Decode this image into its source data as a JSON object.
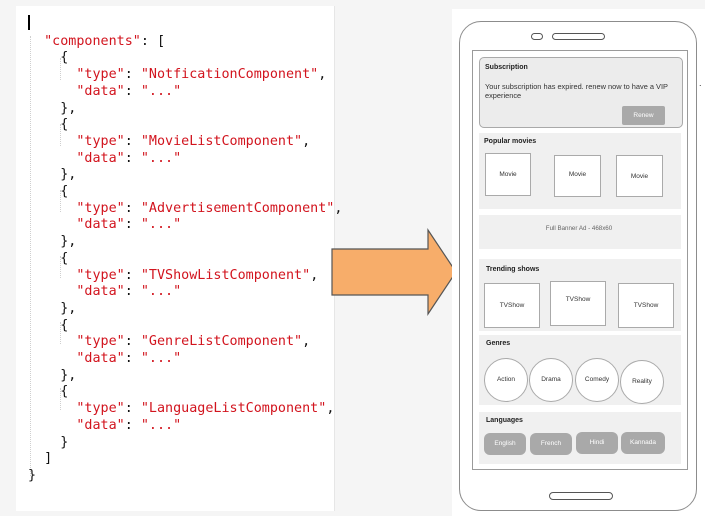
{
  "code": {
    "lines": [
      "{",
      "  \"components\": [",
      "    {",
      "      \"type\": \"NotficationComponent\",",
      "      \"data\": \"...\"",
      "    },",
      "    {",
      "      \"type\": \"MovieListComponent\",",
      "      \"data\": \"...\"",
      "    },",
      "    {",
      "      \"type\": \"AdvertisementComponent\",",
      "      \"data\": \"...\"",
      "    },",
      "    {",
      "      \"type\": \"TVShowListComponent\",",
      "      \"data\": \"...\"",
      "    },",
      "    {",
      "      \"type\": \"GenreListComponent\",",
      "      \"data\": \"...\"",
      "    },",
      "    {",
      "      \"type\": \"LanguageListComponent\",",
      "      \"data\": \"...\"",
      "    }",
      "  ]",
      "}"
    ],
    "key_color": "#d2141e"
  },
  "arrow": {
    "fill": "#f7ad6a",
    "stroke": "#555555"
  },
  "phone": {
    "subscription": {
      "title": "Subscription",
      "message": "Your subscription has expired. renew now to have a VIP experience",
      "button": "Renew"
    },
    "popular_movies": {
      "title": "Popular movies",
      "items": [
        "Movie",
        "Movie",
        "Movie"
      ]
    },
    "ad": {
      "text": "Full Banner Ad - 468x60"
    },
    "trending_shows": {
      "title": "Trending shows",
      "items": [
        "TVShow",
        "TVShow",
        "TVShow"
      ]
    },
    "genres": {
      "title": "Genres",
      "items": [
        "Action",
        "Drama",
        "Comedy",
        "Reality"
      ]
    },
    "languages": {
      "title": "Languages",
      "items": [
        "English",
        "French",
        "Hindi",
        "Kannada"
      ]
    }
  },
  "edge_mark": "."
}
